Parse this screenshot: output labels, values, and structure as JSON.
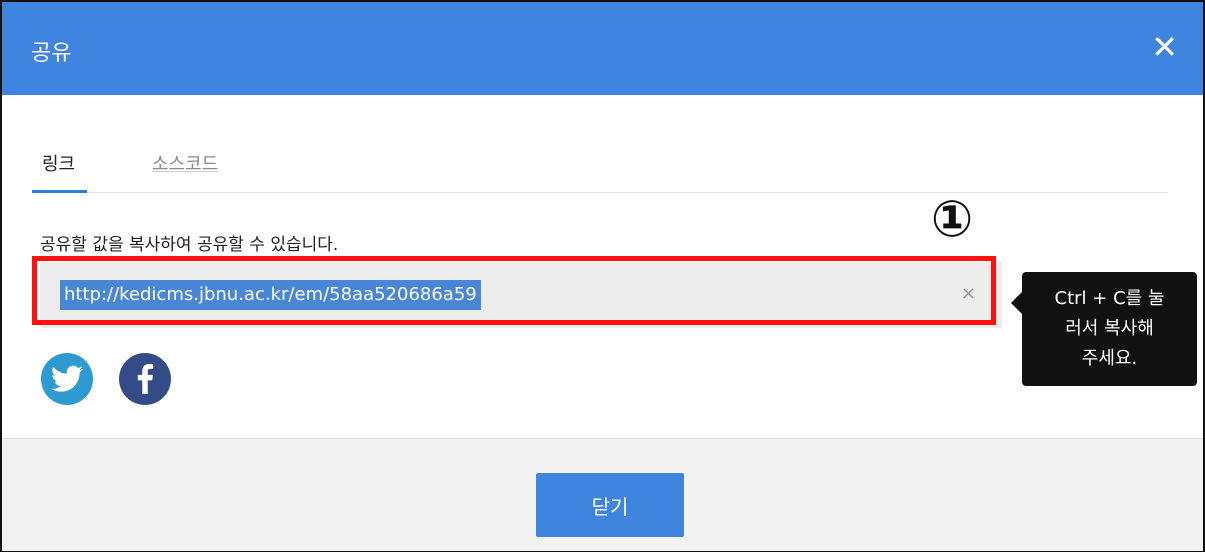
{
  "dialog": {
    "title": "공유",
    "close_glyph": "✕",
    "tabs": [
      {
        "label": "링크",
        "active": true
      },
      {
        "label": "소스코드",
        "active": false
      }
    ],
    "description": "공유할 값을 복사하여 공유할 수 있습니다.",
    "link_url": "http://kedicms.jbnu.ac.kr/em/58aa520686a59",
    "clear_glyph": "×",
    "tooltip_lines": [
      "Ctrl + C를 눌",
      "러서 복사해",
      "주세요."
    ],
    "annotation_number": "①",
    "social_icons": [
      "twitter-icon",
      "facebook-icon"
    ],
    "footer": {
      "close_button_label": "닫기"
    }
  },
  "colors": {
    "header_blue": "#3f84de",
    "highlight_blue": "#4a86d6",
    "annotation_red": "#ff1010",
    "twitter": "#2d9bd2",
    "facebook": "#334b87"
  }
}
